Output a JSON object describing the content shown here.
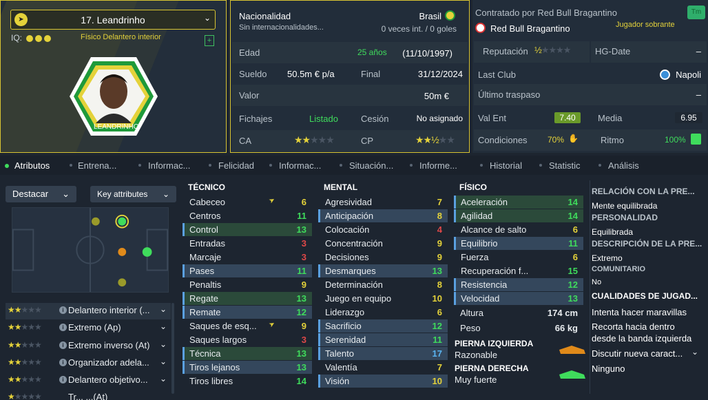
{
  "player": {
    "name_label": "17. Leandrinho",
    "iq_label": "IQ:",
    "position_line": "Físico  Delantero interior",
    "badge_name": "LEANDRINHO"
  },
  "mid": {
    "nationality_label": "Nacionalidad",
    "nationality_value": "Brasil",
    "intl_label": "Sin internacionalidades...",
    "intl_value": "0 veces int. / 0 goles",
    "age_label": "Edad",
    "age_value": "25 años",
    "dob_value": "(11/10/1997)",
    "wage_label": "Sueldo",
    "wage_value": "50.5m € p/a",
    "end_label": "Final",
    "end_value": "31/12/2024",
    "value_label": "Valor",
    "value_value": "50m €",
    "transfer_label": "Fichajes",
    "transfer_value": "Listado",
    "loan_label": "Cesión",
    "loan_value": "No asignado",
    "ca_label": "CA",
    "cp_label": "CP",
    "ca_stars": "★★★★★",
    "cp_stars": "★★★★★"
  },
  "right": {
    "contracted_label": "Contratado por Red Bull Bragantino",
    "club_name": "Red Bull Bragantino",
    "surplus_label": "Jugador sobrante",
    "tm_label": "Tm",
    "rep_label": "Reputación",
    "rep_stars": "★★★★★",
    "hg_label": "HG-Date",
    "hg_value": "–",
    "last_club_label": "Last Club",
    "last_club_value": "Napoli",
    "last_transfer_label": "Último traspaso",
    "last_transfer_value": "–",
    "val_ent_label": "Val Ent",
    "val_ent_value": "7.40",
    "media_label": "Media",
    "media_value": "6.95",
    "cond_label": "Condiciones",
    "cond_value": "70%",
    "ritmo_label": "Ritmo",
    "ritmo_value": "100%"
  },
  "tabs": [
    "Atributos",
    "Entrena...",
    "Informac...",
    "Felicidad",
    "Informac...",
    "Situación...",
    "Informe...",
    "Historial",
    "Statistic",
    "Análisis"
  ],
  "left_panel": {
    "highlight_label": "Destacar",
    "key_attr_label": "Key attributes",
    "roles": [
      {
        "name": "Delantero interior (..."
      },
      {
        "name": "Extremo (Ap)"
      },
      {
        "name": "Extremo inverso (At)"
      },
      {
        "name": "Organizador adela..."
      },
      {
        "name": "Delantero objetivo..."
      },
      {
        "name": "Tr... ...(At)"
      }
    ]
  },
  "tecnico": {
    "title": "TÉCNICO",
    "attrs": [
      {
        "name": "Cabeceo",
        "value": "6"
      },
      {
        "name": "Centros",
        "value": "11"
      },
      {
        "name": "Control",
        "value": "13"
      },
      {
        "name": "Entradas",
        "value": "3"
      },
      {
        "name": "Marcaje",
        "value": "3"
      },
      {
        "name": "Pases",
        "value": "11"
      },
      {
        "name": "Penaltis",
        "value": "9"
      },
      {
        "name": "Regate",
        "value": "13"
      },
      {
        "name": "Remate",
        "value": "12"
      },
      {
        "name": "Saques de esq...",
        "value": "9"
      },
      {
        "name": "Saques largos",
        "value": "3"
      },
      {
        "name": "Técnica",
        "value": "13"
      },
      {
        "name": "Tiros lejanos",
        "value": "13"
      },
      {
        "name": "Tiros libres",
        "value": "14"
      }
    ]
  },
  "mental": {
    "title": "MENTAL",
    "attrs": [
      {
        "name": "Agresividad",
        "value": "7"
      },
      {
        "name": "Anticipación",
        "value": "8"
      },
      {
        "name": "Colocación",
        "value": "4"
      },
      {
        "name": "Concentración",
        "value": "9"
      },
      {
        "name": "Decisiones",
        "value": "9"
      },
      {
        "name": "Desmarques",
        "value": "13"
      },
      {
        "name": "Determinación",
        "value": "8"
      },
      {
        "name": "Juego en equipo",
        "value": "10"
      },
      {
        "name": "Liderazgo",
        "value": "6"
      },
      {
        "name": "Sacrificio",
        "value": "12"
      },
      {
        "name": "Serenidad",
        "value": "11"
      },
      {
        "name": "Talento",
        "value": "17"
      },
      {
        "name": "Valentía",
        "value": "7"
      },
      {
        "name": "Visión",
        "value": "10"
      }
    ]
  },
  "fisico": {
    "title": "FÍSICO",
    "attrs": [
      {
        "name": "Aceleración",
        "value": "14"
      },
      {
        "name": "Agilidad",
        "value": "14"
      },
      {
        "name": "Alcance de salto",
        "value": "6"
      },
      {
        "name": "Equilibrio",
        "value": "11"
      },
      {
        "name": "Fuerza",
        "value": "6"
      },
      {
        "name": "Recuperación f...",
        "value": "15"
      },
      {
        "name": "Resistencia",
        "value": "12"
      },
      {
        "name": "Velocidad",
        "value": "13"
      }
    ],
    "height_label": "Altura",
    "height_value": "174 cm",
    "weight_label": "Peso",
    "weight_value": "66 kg",
    "left_foot_label": "PIERNA IZQUIERDA",
    "left_foot_value": "Razonable",
    "right_foot_label": "PIERNA DERECHA",
    "right_foot_value": "Muy fuerte"
  },
  "info_col": {
    "h1": "RELACIÓN CON LA PRE...",
    "v1": "Mente equilibrada",
    "h2": "PERSONALIDAD",
    "v2": "Equilibrada",
    "h3": "DESCRIPCIÓN DE LA PRE...",
    "v3": "Extremo",
    "h4": "COMUNITARIO",
    "v4": "No",
    "h5": "CUALIDADES DE JUGAD...",
    "v5a": "Intenta hacer maravillas",
    "v5b": "Recorta hacia dentro",
    "v5c": "desde la banda izquierda",
    "v5d": "Discutir nueva caract...",
    "v5e": "Ninguno"
  }
}
